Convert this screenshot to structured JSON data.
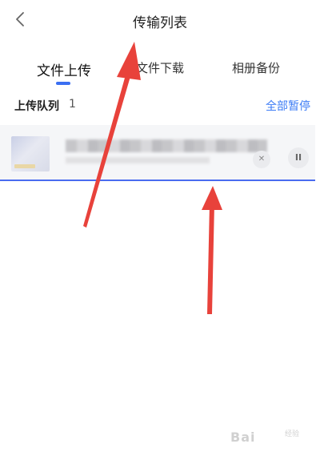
{
  "header": {
    "title": "传输列表",
    "back_icon": "chevron-left-icon"
  },
  "tabs": [
    {
      "label": "文件上传",
      "active": true
    },
    {
      "label": "文件下载",
      "active": false
    },
    {
      "label": "相册备份",
      "active": false
    }
  ],
  "queue": {
    "label": "上传队列",
    "count": "1",
    "pause_all_label": "全部暂停"
  },
  "upload_item": {
    "cancel_icon": "close-icon",
    "pause_icon": "pause-icon",
    "pause_glyph": "II",
    "cancel_glyph": "✕",
    "progress": 1.0
  },
  "colors": {
    "accent": "#3b6ff2",
    "link": "#3b7bf5",
    "progress": "#4a6cf0",
    "annotation_arrow": "#e8423b"
  },
  "watermark": {
    "text": "Bai",
    "sub": "经验"
  }
}
